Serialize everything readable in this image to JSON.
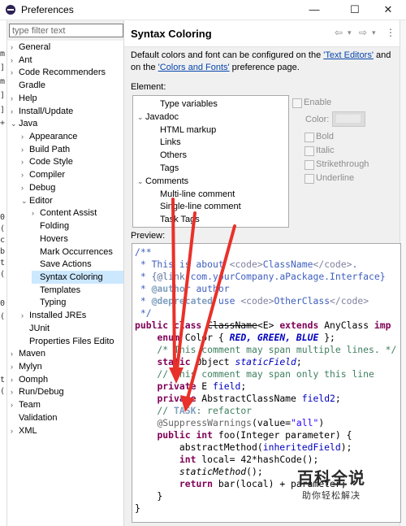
{
  "window": {
    "title": "Preferences",
    "minimize": "—",
    "maximize": "☐",
    "close": "✕"
  },
  "left_strip_chars": [
    "m",
    "]",
    "m",
    "]",
    "]",
    "+",
    "0",
    "(",
    "c",
    "b",
    "t",
    "(",
    "0",
    "(",
    "t",
    "("
  ],
  "filter": {
    "placeholder": "type filter text"
  },
  "tree": [
    {
      "label": "General",
      "level": 0,
      "arrow": ">"
    },
    {
      "label": "Ant",
      "level": 0,
      "arrow": ">"
    },
    {
      "label": "Code Recommenders",
      "level": 0,
      "arrow": ">"
    },
    {
      "label": "Gradle",
      "level": 0,
      "arrow": ""
    },
    {
      "label": "Help",
      "level": 0,
      "arrow": ">"
    },
    {
      "label": "Install/Update",
      "level": 0,
      "arrow": ">"
    },
    {
      "label": "Java",
      "level": 0,
      "arrow": "v"
    },
    {
      "label": "Appearance",
      "level": 1,
      "arrow": ">"
    },
    {
      "label": "Build Path",
      "level": 1,
      "arrow": ">"
    },
    {
      "label": "Code Style",
      "level": 1,
      "arrow": ">"
    },
    {
      "label": "Compiler",
      "level": 1,
      "arrow": ">"
    },
    {
      "label": "Debug",
      "level": 1,
      "arrow": ">"
    },
    {
      "label": "Editor",
      "level": 1,
      "arrow": "v"
    },
    {
      "label": "Content Assist",
      "level": 2,
      "arrow": ">"
    },
    {
      "label": "Folding",
      "level": 2,
      "arrow": ""
    },
    {
      "label": "Hovers",
      "level": 2,
      "arrow": ""
    },
    {
      "label": "Mark Occurrences",
      "level": 2,
      "arrow": ""
    },
    {
      "label": "Save Actions",
      "level": 2,
      "arrow": ""
    },
    {
      "label": "Syntax Coloring",
      "level": 2,
      "arrow": "",
      "selected": true
    },
    {
      "label": "Templates",
      "level": 2,
      "arrow": ""
    },
    {
      "label": "Typing",
      "level": 2,
      "arrow": ""
    },
    {
      "label": "Installed JREs",
      "level": 1,
      "arrow": ">"
    },
    {
      "label": "JUnit",
      "level": 1,
      "arrow": ""
    },
    {
      "label": "Properties Files Edito",
      "level": 1,
      "arrow": ""
    },
    {
      "label": "Maven",
      "level": 0,
      "arrow": ">"
    },
    {
      "label": "Mylyn",
      "level": 0,
      "arrow": ">"
    },
    {
      "label": "Oomph",
      "level": 0,
      "arrow": ">"
    },
    {
      "label": "Run/Debug",
      "level": 0,
      "arrow": ">"
    },
    {
      "label": "Team",
      "level": 0,
      "arrow": ">"
    },
    {
      "label": "Validation",
      "level": 0,
      "arrow": ""
    },
    {
      "label": "XML",
      "level": 0,
      "arrow": ">"
    }
  ],
  "page": {
    "title": "Syntax Coloring",
    "nav_back": "⇦",
    "nav_fwd": "⇨",
    "nav_drop": "▾",
    "menu": "⋮",
    "desc_1": "Default colors and font can be configured on the ",
    "desc_link1": "'Text Editors'",
    "desc_2": " and on the ",
    "desc_link2": "'Colors and Fonts'",
    "desc_3": " preference page.",
    "element_label": "Element:",
    "preview_label": "Preview:"
  },
  "elements": [
    {
      "label": "Type variables",
      "level": 1,
      "arrow": ""
    },
    {
      "label": "Javadoc",
      "level": 0,
      "arrow": "v"
    },
    {
      "label": "HTML markup",
      "level": 1,
      "arrow": ""
    },
    {
      "label": "Links",
      "level": 1,
      "arrow": ""
    },
    {
      "label": "Others",
      "level": 1,
      "arrow": ""
    },
    {
      "label": "Tags",
      "level": 1,
      "arrow": ""
    },
    {
      "label": "Comments",
      "level": 0,
      "arrow": "v"
    },
    {
      "label": "Multi-line comment",
      "level": 1,
      "arrow": ""
    },
    {
      "label": "Single-line comment",
      "level": 1,
      "arrow": ""
    },
    {
      "label": "Task Tags",
      "level": 1,
      "arrow": ""
    }
  ],
  "options": {
    "enable": "Enable",
    "color": "Color:",
    "bold": "Bold",
    "italic": "Italic",
    "strikethrough": "Strikethrough",
    "underline": "Underline"
  },
  "code": {
    "l1": "/**",
    "l2a": " * This is about ",
    "l2b": "<code>",
    "l2c": "ClassName",
    "l2d": "</code>",
    "l2e": ".",
    "l3a": " * ",
    "l3b": "{@link",
    "l3c": " com.yourCompany.aPackage.Interface}",
    "l4a": " * ",
    "l4b": "@author",
    "l4c": " author",
    "l5a": " * ",
    "l5b": "@deprecated",
    "l5c": " use ",
    "l5d": "<code>",
    "l5e": "OtherClass",
    "l5f": "</code>",
    "l6": " */",
    "l7a": "public class",
    "l7b": " ",
    "l7c": "ClassName",
    "l7d": "<E> ",
    "l7e": "extends",
    "l7f": " AnyClass ",
    "l7g": "imp",
    "l8a": "    ",
    "l8b": "enum",
    "l8c": " Color { ",
    "l8d": "RED, GREEN, BLUE",
    "l8e": " };",
    "l9": "    /* This comment may span multiple lines. */",
    "l10a": "    ",
    "l10b": "static",
    "l10c": " Object ",
    "l10d": "staticField",
    "l10e": ";",
    "l11": "    // This comment may span only this line",
    "l12a": "    ",
    "l12b": "private",
    "l12c": " E ",
    "l12d": "field",
    "l12e": ";",
    "l13a": "    ",
    "l13b": "private",
    "l13c": " AbstractClassName ",
    "l13d": "field2",
    "l13e": ";",
    "l14a": "    // ",
    "l14b": "TASK",
    "l14c": ": refactor",
    "l15a": "    ",
    "l15b": "@SuppressWarnings",
    "l15c": "(value=",
    "l15d": "\"all\"",
    "l15e": ")",
    "l16a": "    ",
    "l16b": "public int",
    "l16c": " foo(Integer parameter) {",
    "l17a": "        abstractMethod(",
    "l17b": "inheritedField",
    "l17c": ");",
    "l18a": "        ",
    "l18b": "int",
    "l18c": " local= 42*hashCode();",
    "l19a": "        ",
    "l19b": "staticMethod",
    "l19c": "();",
    "l20a": "        ",
    "l20b": "return",
    "l20c": " bar(local) + parameter;",
    "l21": "    }",
    "l22": "}"
  },
  "watermark": {
    "title": "百科全说",
    "subtitle": "助你轻松解决"
  },
  "colors": {
    "selection": "#cce8ff",
    "arrow": "#e8312a",
    "link": "#0645ad"
  }
}
